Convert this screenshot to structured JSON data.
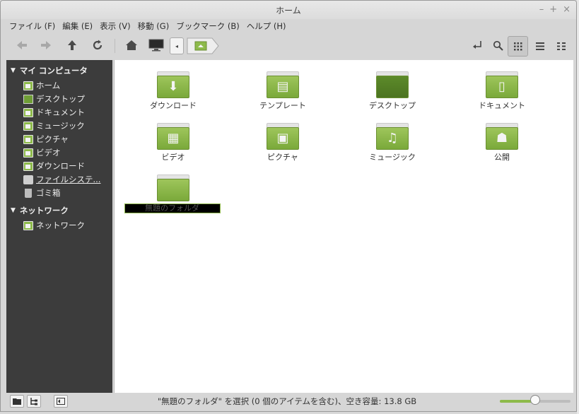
{
  "window": {
    "title": "ホーム"
  },
  "window_controls": {
    "minimize": "–",
    "maximize": "+",
    "close": "×"
  },
  "menu": [
    "ファイル (F)",
    "編集 (E)",
    "表示 (V)",
    "移動 (G)",
    "ブックマーク (B)",
    "ヘルプ (H)"
  ],
  "toolbar_icons": {
    "back": "back-arrow-icon",
    "forward": "forward-arrow-icon",
    "up": "up-arrow-icon",
    "reload": "reload-icon",
    "home": "home-icon",
    "computer": "computer-icon",
    "path_left": "◂",
    "toggle_location": "toggle-location-icon",
    "search": "search-icon",
    "icon_view": "grid-view-icon",
    "list_view": "list-view-icon",
    "compact_view": "compact-view-icon"
  },
  "sidebar": {
    "sections": [
      {
        "title": "マイ コンピュータ",
        "items": [
          {
            "label": "ホーム",
            "icon": "home-folder-icon"
          },
          {
            "label": "デスクトップ",
            "icon": "desktop-icon"
          },
          {
            "label": "ドキュメント",
            "icon": "documents-folder-icon"
          },
          {
            "label": "ミュージック",
            "icon": "music-folder-icon"
          },
          {
            "label": "ピクチャ",
            "icon": "pictures-folder-icon"
          },
          {
            "label": "ビデオ",
            "icon": "videos-folder-icon"
          },
          {
            "label": "ダウンロード",
            "icon": "downloads-folder-icon"
          },
          {
            "label": "ファイルシステ...",
            "icon": "filesystem-icon"
          },
          {
            "label": "ゴミ箱",
            "icon": "trash-icon"
          }
        ]
      },
      {
        "title": "ネットワーク",
        "items": [
          {
            "label": "ネットワーク",
            "icon": "network-icon"
          }
        ]
      }
    ]
  },
  "files": [
    {
      "label": "ダウンロード",
      "glyph": "⬇",
      "icon": "download-folder-icon"
    },
    {
      "label": "テンプレート",
      "glyph": "▤",
      "icon": "templates-folder-icon"
    },
    {
      "label": "デスクトップ",
      "glyph": "",
      "icon": "desktop-folder-icon"
    },
    {
      "label": "ドキュメント",
      "glyph": "▯",
      "icon": "documents-folder-icon"
    },
    {
      "label": "ビデオ",
      "glyph": "▦",
      "icon": "videos-folder-icon"
    },
    {
      "label": "ピクチャ",
      "glyph": "▣",
      "icon": "pictures-folder-icon"
    },
    {
      "label": "ミュージック",
      "glyph": "♫",
      "icon": "music-folder-icon"
    },
    {
      "label": "公開",
      "glyph": "☗",
      "icon": "public-folder-icon"
    }
  ],
  "new_folder": {
    "name": "無題のフォルダ",
    "icon": "folder-icon"
  },
  "statusbar": {
    "text": "\"無題のフォルダ\" を選択 (0 個のアイテムを含む)、空き容量: 13.8 GB",
    "zoom_level": 0.5
  },
  "colors": {
    "accent": "#8dba4a",
    "sidebar_bg": "#3c3c3c"
  }
}
